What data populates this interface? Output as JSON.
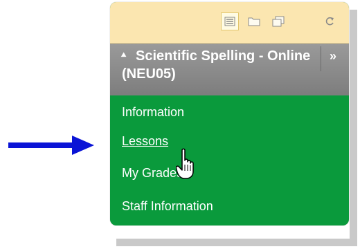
{
  "course": {
    "title": "Scientific Spelling - Online (NEU05)"
  },
  "toolbar": {
    "icons": [
      "list-view-icon",
      "folder-icon",
      "window-icon",
      "refresh-icon"
    ]
  },
  "menu": {
    "items": [
      {
        "label": "Information"
      },
      {
        "label": "Lessons"
      },
      {
        "label": "My Grades"
      },
      {
        "label": "Staff Information"
      }
    ]
  },
  "colors": {
    "menu_bg": "#0a9a3c",
    "header_bg": "#8a8a8a",
    "toolbar_bg": "#fbe6b0",
    "arrow": "#0a14d6"
  }
}
